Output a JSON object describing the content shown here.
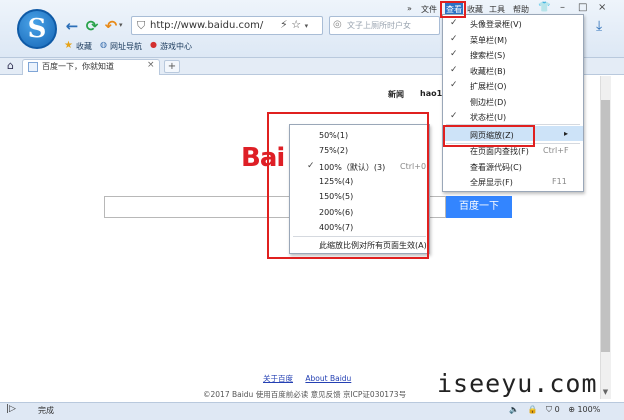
{
  "browser": {
    "address": "http://www.baidu.com/",
    "search_placeholder": "文子上厕所时户女",
    "nav": {
      "back_icon": "back-arrow-icon",
      "refresh_icon": "refresh-icon",
      "undo_icon": "undo-icon"
    },
    "menubar": {
      "chevron": "»",
      "items": [
        "文件",
        "查看",
        "收藏",
        "工具",
        "帮助"
      ]
    },
    "favorites_bar": [
      "收藏",
      "网址导航",
      "游戏中心"
    ],
    "tab": {
      "title": "百度一下，你就知道",
      "close": "×",
      "new": "+"
    },
    "status": {
      "text": "完成",
      "zoom": "100%",
      "badge": "0"
    }
  },
  "page": {
    "top_links": [
      "新闻",
      "hao12"
    ],
    "logo_text": "Bai",
    "search_button": "百度一下",
    "footer_links": [
      "关于百度",
      "About Baidu"
    ],
    "footer_copy": "©2017 Baidu 使用百度前必读 意见反馈 京ICP证030173号",
    "watermark": "iseeyu.com"
  },
  "view_menu": {
    "items": [
      {
        "label": "头像登录框(V)",
        "checked": true
      },
      {
        "label": "菜单栏(M)",
        "checked": true
      },
      {
        "label": "搜索栏(S)",
        "checked": true
      },
      {
        "label": "收藏栏(B)",
        "checked": true
      },
      {
        "label": "扩展栏(O)",
        "checked": true
      },
      {
        "label": "侧边栏(D)",
        "checked": false
      },
      {
        "label": "状态栏(U)",
        "checked": true
      }
    ],
    "zoom_item": "网页缩放(Z)",
    "zoom_arrow": "▸",
    "find_item": "在页面内查找(F)",
    "find_shortcut": "Ctrl+F",
    "source_item": "查看源代码(C)",
    "fullscreen_item": "全屏显示(F)",
    "fullscreen_shortcut": "F11"
  },
  "zoom_menu": {
    "items": [
      {
        "label": "50%(1)",
        "checked": false,
        "shortcut": ""
      },
      {
        "label": "75%(2)",
        "checked": false,
        "shortcut": ""
      },
      {
        "label": "100%（默认）(3)",
        "checked": true,
        "shortcut": "Ctrl+0"
      },
      {
        "label": "125%(4)",
        "checked": false,
        "shortcut": ""
      },
      {
        "label": "150%(5)",
        "checked": false,
        "shortcut": ""
      },
      {
        "label": "200%(6)",
        "checked": false,
        "shortcut": ""
      },
      {
        "label": "400%(7)",
        "checked": false,
        "shortcut": ""
      }
    ],
    "apply_all": "此缩放比例对所有页面生效(A)"
  },
  "colors": {
    "highlight": "#cde3f8",
    "annotation": "#e0201f",
    "baidu_red": "#de1f26",
    "baidu_blue": "#3385ff"
  }
}
